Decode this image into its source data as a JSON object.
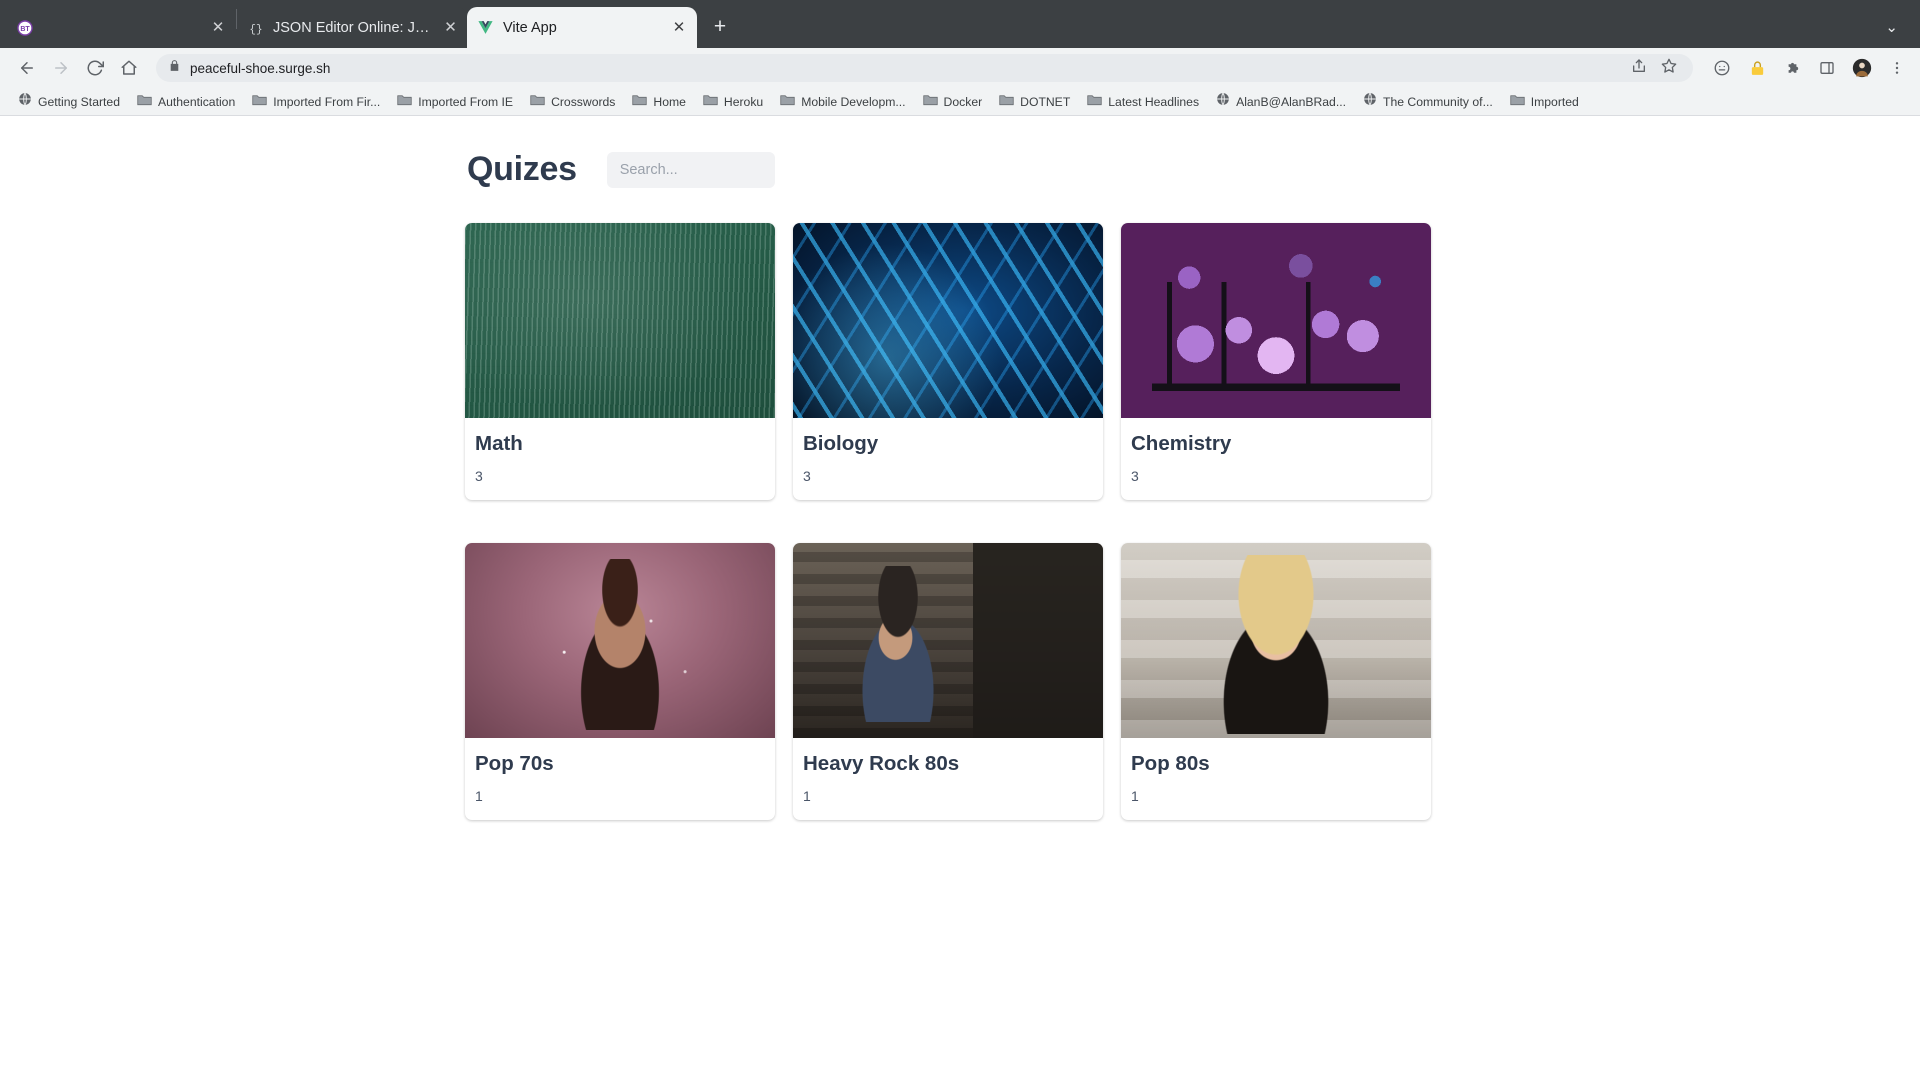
{
  "browser": {
    "tabs": [
      {
        "title": "",
        "favicon": "bt-circle-icon",
        "redacted": true,
        "active": false
      },
      {
        "title": "JSON Editor Online: JSON edit",
        "favicon": "json-braces-icon",
        "redacted": false,
        "active": false
      },
      {
        "title": "Vite App",
        "favicon": "vue-logo-icon",
        "redacted": false,
        "active": true
      }
    ],
    "new_tab_label": "+",
    "window_minimize_label": "⌄",
    "toolbar": {
      "back_label": "←",
      "forward_label": "→",
      "reload_label": "↻",
      "home_label": "⌂",
      "url": "peaceful-shoe.surge.sh",
      "lock_icon": "lock-icon",
      "share_icon": "share-icon",
      "bookmark_star_icon": "star-icon",
      "icons": [
        "profile-circle-icon",
        "password-lock-icon",
        "extensions-puzzle-icon",
        "side-panel-icon",
        "avatar-icon",
        "three-dot-menu-icon"
      ]
    },
    "bookmarks": [
      {
        "label": "Getting Started",
        "icon": "globe-icon"
      },
      {
        "label": "Authentication",
        "icon": "folder-icon"
      },
      {
        "label": "Imported From Fir...",
        "icon": "folder-icon"
      },
      {
        "label": "Imported From IE",
        "icon": "folder-icon"
      },
      {
        "label": "Crosswords",
        "icon": "folder-icon"
      },
      {
        "label": "Home",
        "icon": "folder-icon"
      },
      {
        "label": "Heroku",
        "icon": "folder-icon"
      },
      {
        "label": "Mobile Developm...",
        "icon": "folder-icon"
      },
      {
        "label": "Docker",
        "icon": "folder-icon"
      },
      {
        "label": "DOTNET",
        "icon": "folder-icon"
      },
      {
        "label": "Latest Headlines",
        "icon": "folder-icon"
      },
      {
        "label": "AlanB@AlanBRad...",
        "icon": "globe-icon"
      },
      {
        "label": "The Community of...",
        "icon": "globe-icon"
      },
      {
        "label": "Imported",
        "icon": "folder-icon"
      }
    ]
  },
  "page": {
    "title": "Quizes",
    "search": {
      "value": "",
      "placeholder": "Search..."
    },
    "cards": [
      {
        "title": "Math",
        "count": "3",
        "image": "chalkboard-math-formulas"
      },
      {
        "title": "Biology",
        "count": "3",
        "image": "dna-double-helix"
      },
      {
        "title": "Chemistry",
        "count": "3",
        "image": "chemistry-lab-flasks"
      },
      {
        "title": "Pop 70s",
        "count": "1",
        "image": "disco-singer-photo"
      },
      {
        "title": "Heavy Rock 80s",
        "count": "1",
        "image": "rock-guitarist-photo"
      },
      {
        "title": "Pop 80s",
        "count": "1",
        "image": "pop-singer-80s-photo"
      }
    ]
  },
  "colors": {
    "heading": "#2f3b4e",
    "chrome_dark": "#3c4043",
    "chrome_light": "#f1f3f4",
    "accent_blue": "#1f39e8"
  }
}
